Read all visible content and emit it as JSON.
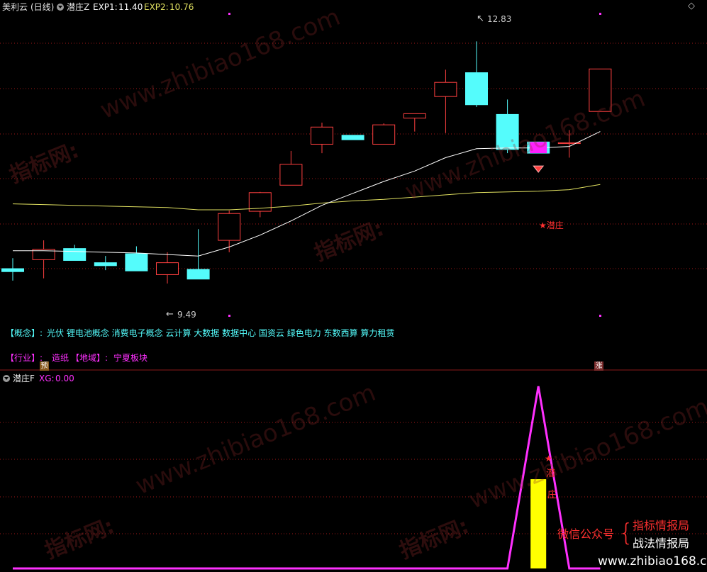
{
  "header": {
    "stock_name": "美利云",
    "period": "(日线)",
    "indicator_name": "潜庄Z",
    "exp1_label": "EXP1:",
    "exp1_value": "11.40",
    "exp2_label": "EXP2:",
    "exp2_value": "10.76"
  },
  "sub_header": {
    "indicator_name": "潜庄F",
    "xg_label": "XG:",
    "xg_value": "0.00"
  },
  "info": {
    "concept_label": "【概念】:",
    "concepts": "光伏 锂电池概念 消费电子概念 云计算 大数据 数据中心 国资云 绿色电力 东数西算 算力租赁",
    "industry_label": "【行业】:",
    "industry": "造纸",
    "region_label": "【地域】:",
    "region": "宁夏板块"
  },
  "annotations": {
    "high_label": "12.83",
    "low_label": "9.49",
    "signal_label": "★潜庄",
    "sub_signal_char1": "潜",
    "sub_signal_char2": "庄",
    "badge_left": "预",
    "badge_right": "涨"
  },
  "watermarks": {
    "cn": "指标网:",
    "url": "www.zhibiao168.com",
    "footer_url": "www.zhibiao168.com"
  },
  "promo": {
    "wechat_label": "微信公众号",
    "line1": "指标情报局",
    "line2": "战法情报局"
  },
  "colors": {
    "up": "#ff4040",
    "down": "#54fcfc",
    "exp1": "#ffffff",
    "exp2": "#e0e060",
    "sub_line": "#ff30ff",
    "sub_bar": "#ffff00",
    "grid": "#a01818"
  },
  "chart_data": [
    {
      "type": "candlestick",
      "ylim": [
        9.2,
        13.1
      ],
      "candles": [
        {
          "o": 9.78,
          "h": 9.92,
          "c": 9.74,
          "l": 9.62
        },
        {
          "o": 9.9,
          "h": 10.16,
          "c": 10.04,
          "l": 9.65
        },
        {
          "o": 10.05,
          "h": 10.1,
          "c": 9.89,
          "l": 9.89
        },
        {
          "o": 9.86,
          "h": 9.95,
          "c": 9.82,
          "l": 9.76
        },
        {
          "o": 9.98,
          "h": 10.08,
          "c": 9.75,
          "l": 9.75
        },
        {
          "o": 9.7,
          "h": 10.0,
          "c": 9.86,
          "l": 9.58
        },
        {
          "o": 9.77,
          "h": 10.31,
          "c": 9.64,
          "l": 9.64
        },
        {
          "o": 10.16,
          "h": 10.56,
          "c": 10.52,
          "l": 10.0
        },
        {
          "o": 10.55,
          "h": 10.81,
          "c": 10.8,
          "l": 10.47
        },
        {
          "o": 10.9,
          "h": 11.36,
          "c": 11.18,
          "l": 10.9
        },
        {
          "o": 11.45,
          "h": 11.74,
          "c": 11.68,
          "l": 11.33
        },
        {
          "o": 11.57,
          "h": 11.57,
          "c": 11.51,
          "l": 11.51
        },
        {
          "o": 11.45,
          "h": 11.73,
          "c": 11.71,
          "l": 11.45
        },
        {
          "o": 11.8,
          "h": 11.86,
          "c": 11.86,
          "l": 11.62
        },
        {
          "o": 12.09,
          "h": 12.45,
          "c": 12.28,
          "l": 11.6
        },
        {
          "o": 12.41,
          "h": 12.83,
          "c": 11.98,
          "l": 11.95
        },
        {
          "o": 11.85,
          "h": 12.05,
          "c": 11.38,
          "l": 11.33
        },
        {
          "o": 11.48,
          "h": 11.48,
          "c": 11.33,
          "l": 11.33
        },
        {
          "o": 11.47,
          "h": 11.64,
          "c": 11.47,
          "l": 11.27
        },
        {
          "o": 11.89,
          "h": 12.46,
          "c": 12.46,
          "l": 11.89
        }
      ],
      "exp1": [
        10.02,
        10.02,
        10.01,
        10.0,
        9.99,
        9.97,
        9.95,
        10.07,
        10.23,
        10.42,
        10.63,
        10.79,
        10.95,
        11.09,
        11.27,
        11.39,
        11.4,
        11.4,
        11.42,
        11.62
      ],
      "exp2": [
        10.65,
        10.64,
        10.63,
        10.62,
        10.61,
        10.6,
        10.57,
        10.57,
        10.59,
        10.62,
        10.66,
        10.69,
        10.71,
        10.74,
        10.77,
        10.8,
        10.81,
        10.82,
        10.84,
        10.91
      ]
    },
    {
      "type": "line",
      "ylim": [
        0,
        100
      ],
      "values": [
        0,
        0,
        0,
        0,
        0,
        0,
        0,
        0,
        0,
        0,
        0,
        0,
        0,
        0,
        0,
        0,
        0,
        100,
        0,
        0
      ],
      "bar_values": [
        0,
        0,
        0,
        0,
        0,
        0,
        0,
        0,
        0,
        0,
        0,
        0,
        0,
        0,
        0,
        0,
        0,
        49,
        0,
        0
      ]
    }
  ]
}
